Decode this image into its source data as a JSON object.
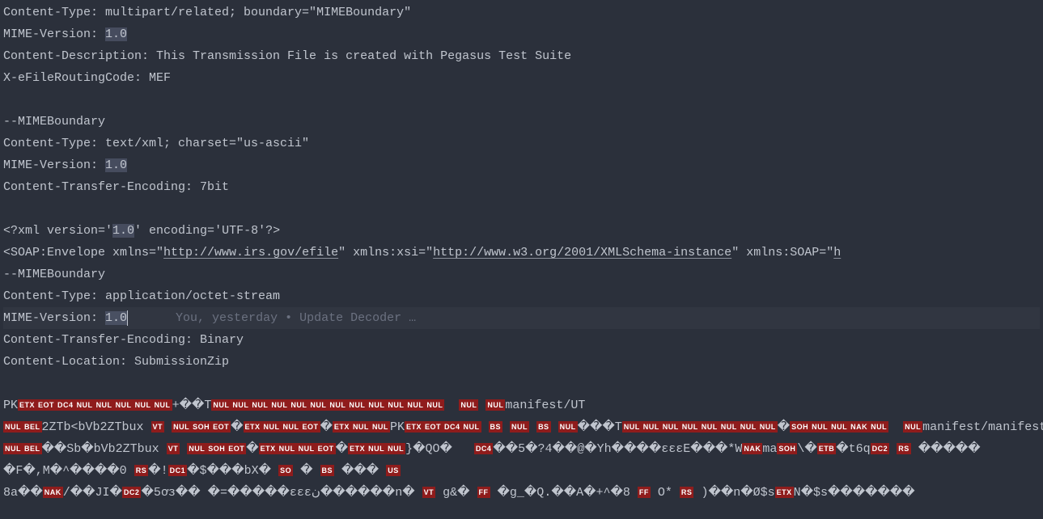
{
  "lines": {
    "l1": "Content-Type: multipart/related; boundary=\"MIMEBoundary\"",
    "l2_a": "MIME-Version: ",
    "l2_b": "1.0",
    "l3": "Content-Description: This Transmission File is created with Pegasus Test Suite",
    "l4": "X-eFileRoutingCode: MEF",
    "l5": "",
    "l6": "--MIMEBoundary",
    "l7": "Content-Type: text/xml; charset=\"us-ascii\"",
    "l8_a": "MIME-Version: ",
    "l8_b": "1.0",
    "l9": "Content-Transfer-Encoding: 7bit",
    "l10": "",
    "l11_a": "<?xml version='",
    "l11_b": "1.0",
    "l11_c": "' encoding='UTF-8'?>",
    "l12_a": "<SOAP:Envelope xmlns=\"",
    "l12_url1": "http://www.irs.gov/efile",
    "l12_b": "\" xmlns:xsi=\"",
    "l12_url2": "http://www.w3.org/2001/XMLSchema-instance",
    "l12_c": "\" xmlns:SOAP=\"",
    "l12_d": "h",
    "l13": "--MIMEBoundary",
    "l14": "Content-Type: application/octet-stream",
    "l15_a": "MIME-Version: ",
    "l15_b": "1.0",
    "l15_blame": "You, yesterday • Update Decoder …",
    "l16": "Content-Transfer-Encoding: Binary",
    "l17": "Content-Location: SubmissionZip",
    "l18": "",
    "b1_pk": "PK",
    "b1_mid1": "+��T",
    "b1_tail": "manifest/UT",
    "b2_pre": "2ZTb<bVb2ZTbux",
    "b2_pk": "PK",
    "b2_mid": "���T",
    "b2_tail": "manifest/manifest.xmlUT",
    "b3_pre": "��Sb�bVb2ZTbux",
    "b3_mid1": "}�QO�",
    "b3_mid2": "��5�?4��@�Yh����ɛɛɛE���*W",
    "b3_ma": "ma",
    "b3_mid3": "\\�",
    "b3_mid4": "�t6q",
    "b3_tail": "�����",
    "b4_a": "�F�,M�^����0",
    "b4_b": "�!",
    "b4_c": "�$���bX�",
    "b4_d": "�",
    "b4_e": "���",
    "b5_a": "8a��",
    "b5_b": "/��JI�",
    "b5_c": "�5ơз��    �=�����ɛɛɛن������n�",
    "b5_d": "g&�",
    "b5_e": "�g_�Q.��A�+^�8",
    "b5_f": "O*",
    "b5_g": ")��n�Ø$s",
    "b5_h": "N�$s�������"
  },
  "ctrls": {
    "etx": "ETX",
    "eot": "EOT",
    "dc4": "DC4",
    "nul": "NUL",
    "bel": "BEL",
    "vt": "VT",
    "soh": "SOH",
    "bs": "BS",
    "nak": "NAK",
    "ff": "FF",
    "rs": "RS",
    "dc1": "DC1",
    "dc2": "DC2",
    "so": "SO",
    "us": "US",
    "etb": "ETB"
  }
}
